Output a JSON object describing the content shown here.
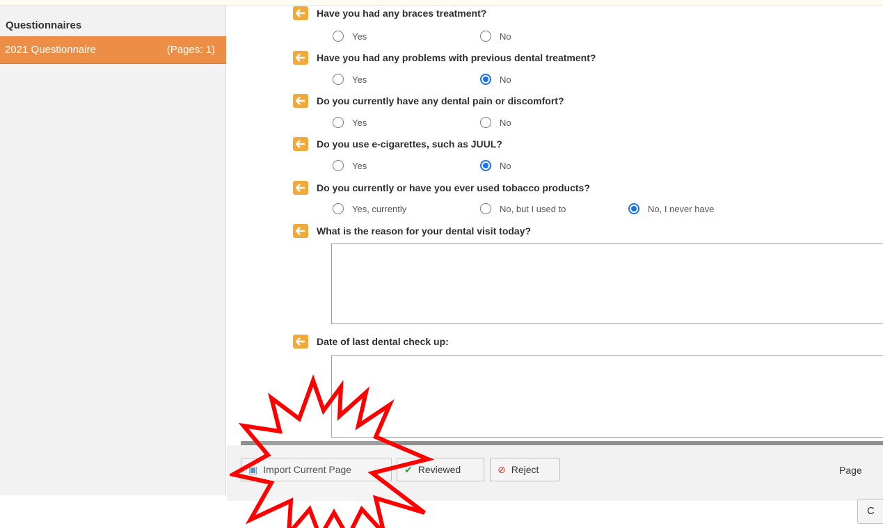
{
  "sidebar": {
    "title": "Questionnaires",
    "items": [
      {
        "label": "2021 Questionnaire",
        "pages": "(Pages: 1)"
      }
    ]
  },
  "questions": [
    {
      "text": "Have you had any braces treatment?",
      "options": [
        "Yes",
        "No"
      ],
      "selected": null
    },
    {
      "text": "Have you had any problems with previous dental treatment?",
      "options": [
        "Yes",
        "No"
      ],
      "selected": 1
    },
    {
      "text": "Do you currently have any dental pain or discomfort?",
      "options": [
        "Yes",
        "No"
      ],
      "selected": null
    },
    {
      "text": "Do you use e-cigarettes, such as JUUL?",
      "options": [
        "Yes",
        "No"
      ],
      "selected": 1
    },
    {
      "text": "Do you currently or have you ever used tobacco products?",
      "options": [
        "Yes, currently",
        "No, but I used to",
        "No, I never have"
      ],
      "selected": 2
    }
  ],
  "text_questions": [
    {
      "text": "What is the reason for your dental visit today?",
      "value": ""
    },
    {
      "text": "Date of last dental check up:",
      "value": ""
    }
  ],
  "toolbar": {
    "import_label": "Import Current Page",
    "reviewed_label": "Reviewed",
    "reject_label": "Reject",
    "page_label": "Page",
    "close_label": "C"
  },
  "icons": {
    "question_arrow": "left-arrow-icon",
    "import": "import-icon",
    "reviewed": "checkmark-icon",
    "reject": "no-entry-icon"
  },
  "colors": {
    "accent_orange": "#ec8e45",
    "arrow_badge": "#f0a93b",
    "radio_selected": "#1a73e8",
    "burst_outline": "#ff0000"
  }
}
